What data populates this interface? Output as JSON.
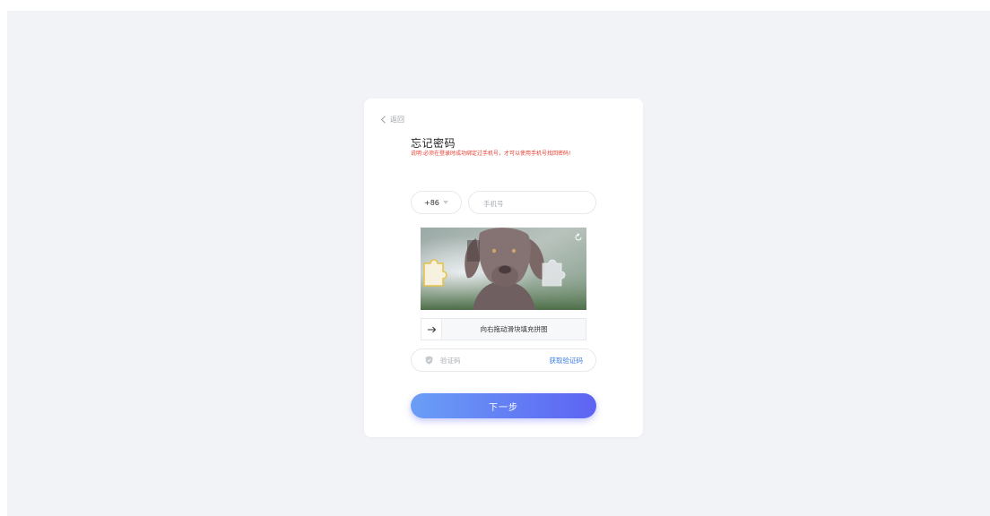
{
  "back": {
    "label": "返回",
    "icon": "chevron-left-icon"
  },
  "form": {
    "title": "忘记密码",
    "note": "说明:必须在登录时成功绑定过手机号，才可以使用手机号找回密码!",
    "country_code": "+86",
    "phone_placeholder": "手机号",
    "captcha": {
      "slider_hint": "向右拖动滑块填充拼图",
      "image_subject": "weimaraner dog portrait",
      "slider_position": 0
    },
    "code_placeholder": "验证码",
    "get_code_label": "获取验证码",
    "next_label": "下一步"
  },
  "colors": {
    "accent_blue": "#3a7ce8",
    "note_red": "#e63b2e",
    "button_gradient_start": "#6a9ef6",
    "button_gradient_end": "#5d63f3",
    "background": "#f2f3f7"
  }
}
